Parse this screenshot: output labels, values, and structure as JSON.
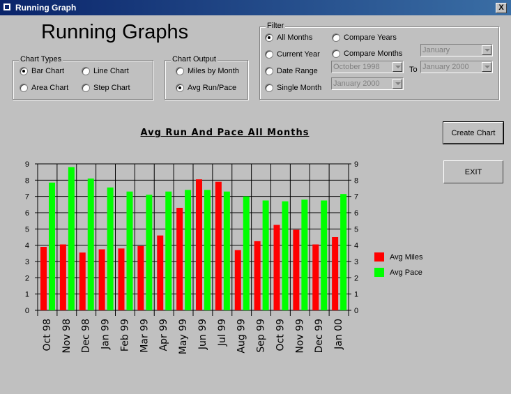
{
  "window": {
    "title": "Running Graph",
    "close_label": "X"
  },
  "app_title": "Running Graphs",
  "chart_types": {
    "label": "Chart Types",
    "options": [
      "Bar Chart",
      "Line Chart",
      "Area Chart",
      "Step Chart"
    ],
    "selected": "Bar Chart"
  },
  "chart_output": {
    "label": "Chart Output",
    "options": [
      "Miles by Month",
      "Avg Run/Pace"
    ],
    "selected": "Avg Run/Pace"
  },
  "filter": {
    "label": "Filter",
    "options": [
      "All Months",
      "Compare Years",
      "Current Year",
      "Compare Months",
      "Date Range",
      "Single Month"
    ],
    "selected": "All Months",
    "month_select": "January",
    "date_from": "October 1998",
    "to_label": "To",
    "date_to": "January 2000",
    "single_month": "January 2000"
  },
  "buttons": {
    "create": "Create Chart",
    "exit": "EXIT"
  },
  "chart_data": {
    "type": "bar",
    "title": "Avg Run And Pace All Months",
    "categories": [
      "Oct 98",
      "Nov 98",
      "Dec 98",
      "Jan 99",
      "Feb 99",
      "Mar 99",
      "Apr 99",
      "May 99",
      "Jun 99",
      "Jul 99",
      "Aug 99",
      "Sep 99",
      "Oct 99",
      "Nov 99",
      "Dec 99",
      "Jan 00"
    ],
    "series": [
      {
        "name": "Avg Miles",
        "color": "#ff0000",
        "values": [
          3.9,
          4.05,
          3.55,
          3.75,
          3.8,
          3.95,
          4.6,
          6.3,
          8.05,
          7.9,
          3.7,
          4.25,
          5.25,
          4.95,
          4.05,
          4.5
        ]
      },
      {
        "name": "Avg Pace",
        "color": "#00ff00",
        "values": [
          7.85,
          8.8,
          8.1,
          7.55,
          7.3,
          7.1,
          7.3,
          7.4,
          7.4,
          7.3,
          7.0,
          6.75,
          6.7,
          6.8,
          6.75,
          7.15
        ]
      }
    ],
    "ylim": [
      0,
      9
    ],
    "yticks": [
      "0",
      "1",
      "2",
      "3",
      "4",
      "5",
      "6",
      "7",
      "8",
      "9"
    ],
    "grid": true,
    "legend": "right"
  }
}
